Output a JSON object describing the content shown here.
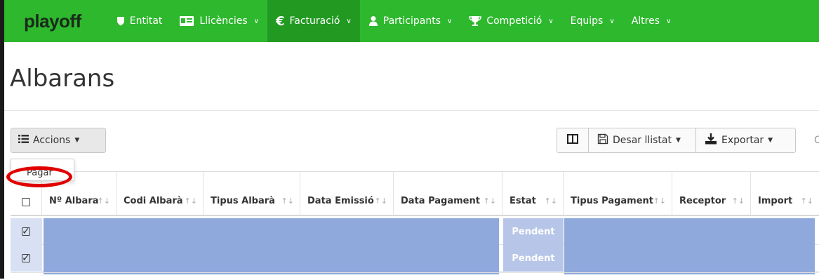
{
  "brand": "playoff",
  "nav": {
    "items": [
      {
        "label": "Entitat",
        "icon": "shield-icon",
        "dropdown": false,
        "active": false
      },
      {
        "label": "Llicències",
        "icon": "id-card-icon",
        "dropdown": true,
        "active": false
      },
      {
        "label": "Facturació",
        "icon": "euro-icon",
        "dropdown": true,
        "active": true
      },
      {
        "label": "Participants",
        "icon": "user-icon",
        "dropdown": true,
        "active": false
      },
      {
        "label": "Competició",
        "icon": "trophy-icon",
        "dropdown": true,
        "active": false
      },
      {
        "label": "Equips",
        "icon": "",
        "dropdown": true,
        "active": false
      },
      {
        "label": "Altres",
        "icon": "",
        "dropdown": true,
        "active": false
      }
    ]
  },
  "page": {
    "title": "Albarans"
  },
  "toolbar": {
    "actions_label": "Accions",
    "save_list_label": "Desar llistat",
    "export_label": "Exportar",
    "cut_letter": "C"
  },
  "dropdown": {
    "items": [
      "Pagar"
    ]
  },
  "table": {
    "columns": [
      {
        "label": "",
        "key": "select"
      },
      {
        "label": "Nº Albara",
        "key": "num"
      },
      {
        "label": "Codi Albarà",
        "key": "codi"
      },
      {
        "label": "Tipus Albarà",
        "key": "tipus"
      },
      {
        "label": "Data Emissió",
        "key": "emissio"
      },
      {
        "label": "Data Pagament",
        "key": "pagament"
      },
      {
        "label": "Estat",
        "key": "estat"
      },
      {
        "label": "Tipus Pagament",
        "key": "tipus_pagament"
      },
      {
        "label": "Receptor",
        "key": "receptor"
      },
      {
        "label": "Import",
        "key": "import"
      }
    ],
    "rows": [
      {
        "checked": true,
        "estat": "Pendent"
      },
      {
        "checked": true,
        "estat": "Pendent"
      }
    ]
  },
  "colors": {
    "navbar": "#2eb82e",
    "navbar_active": "#229a22",
    "selection": "#8fa9dc",
    "status_bg": "#b7c6e8",
    "annotation": "#e00000"
  }
}
